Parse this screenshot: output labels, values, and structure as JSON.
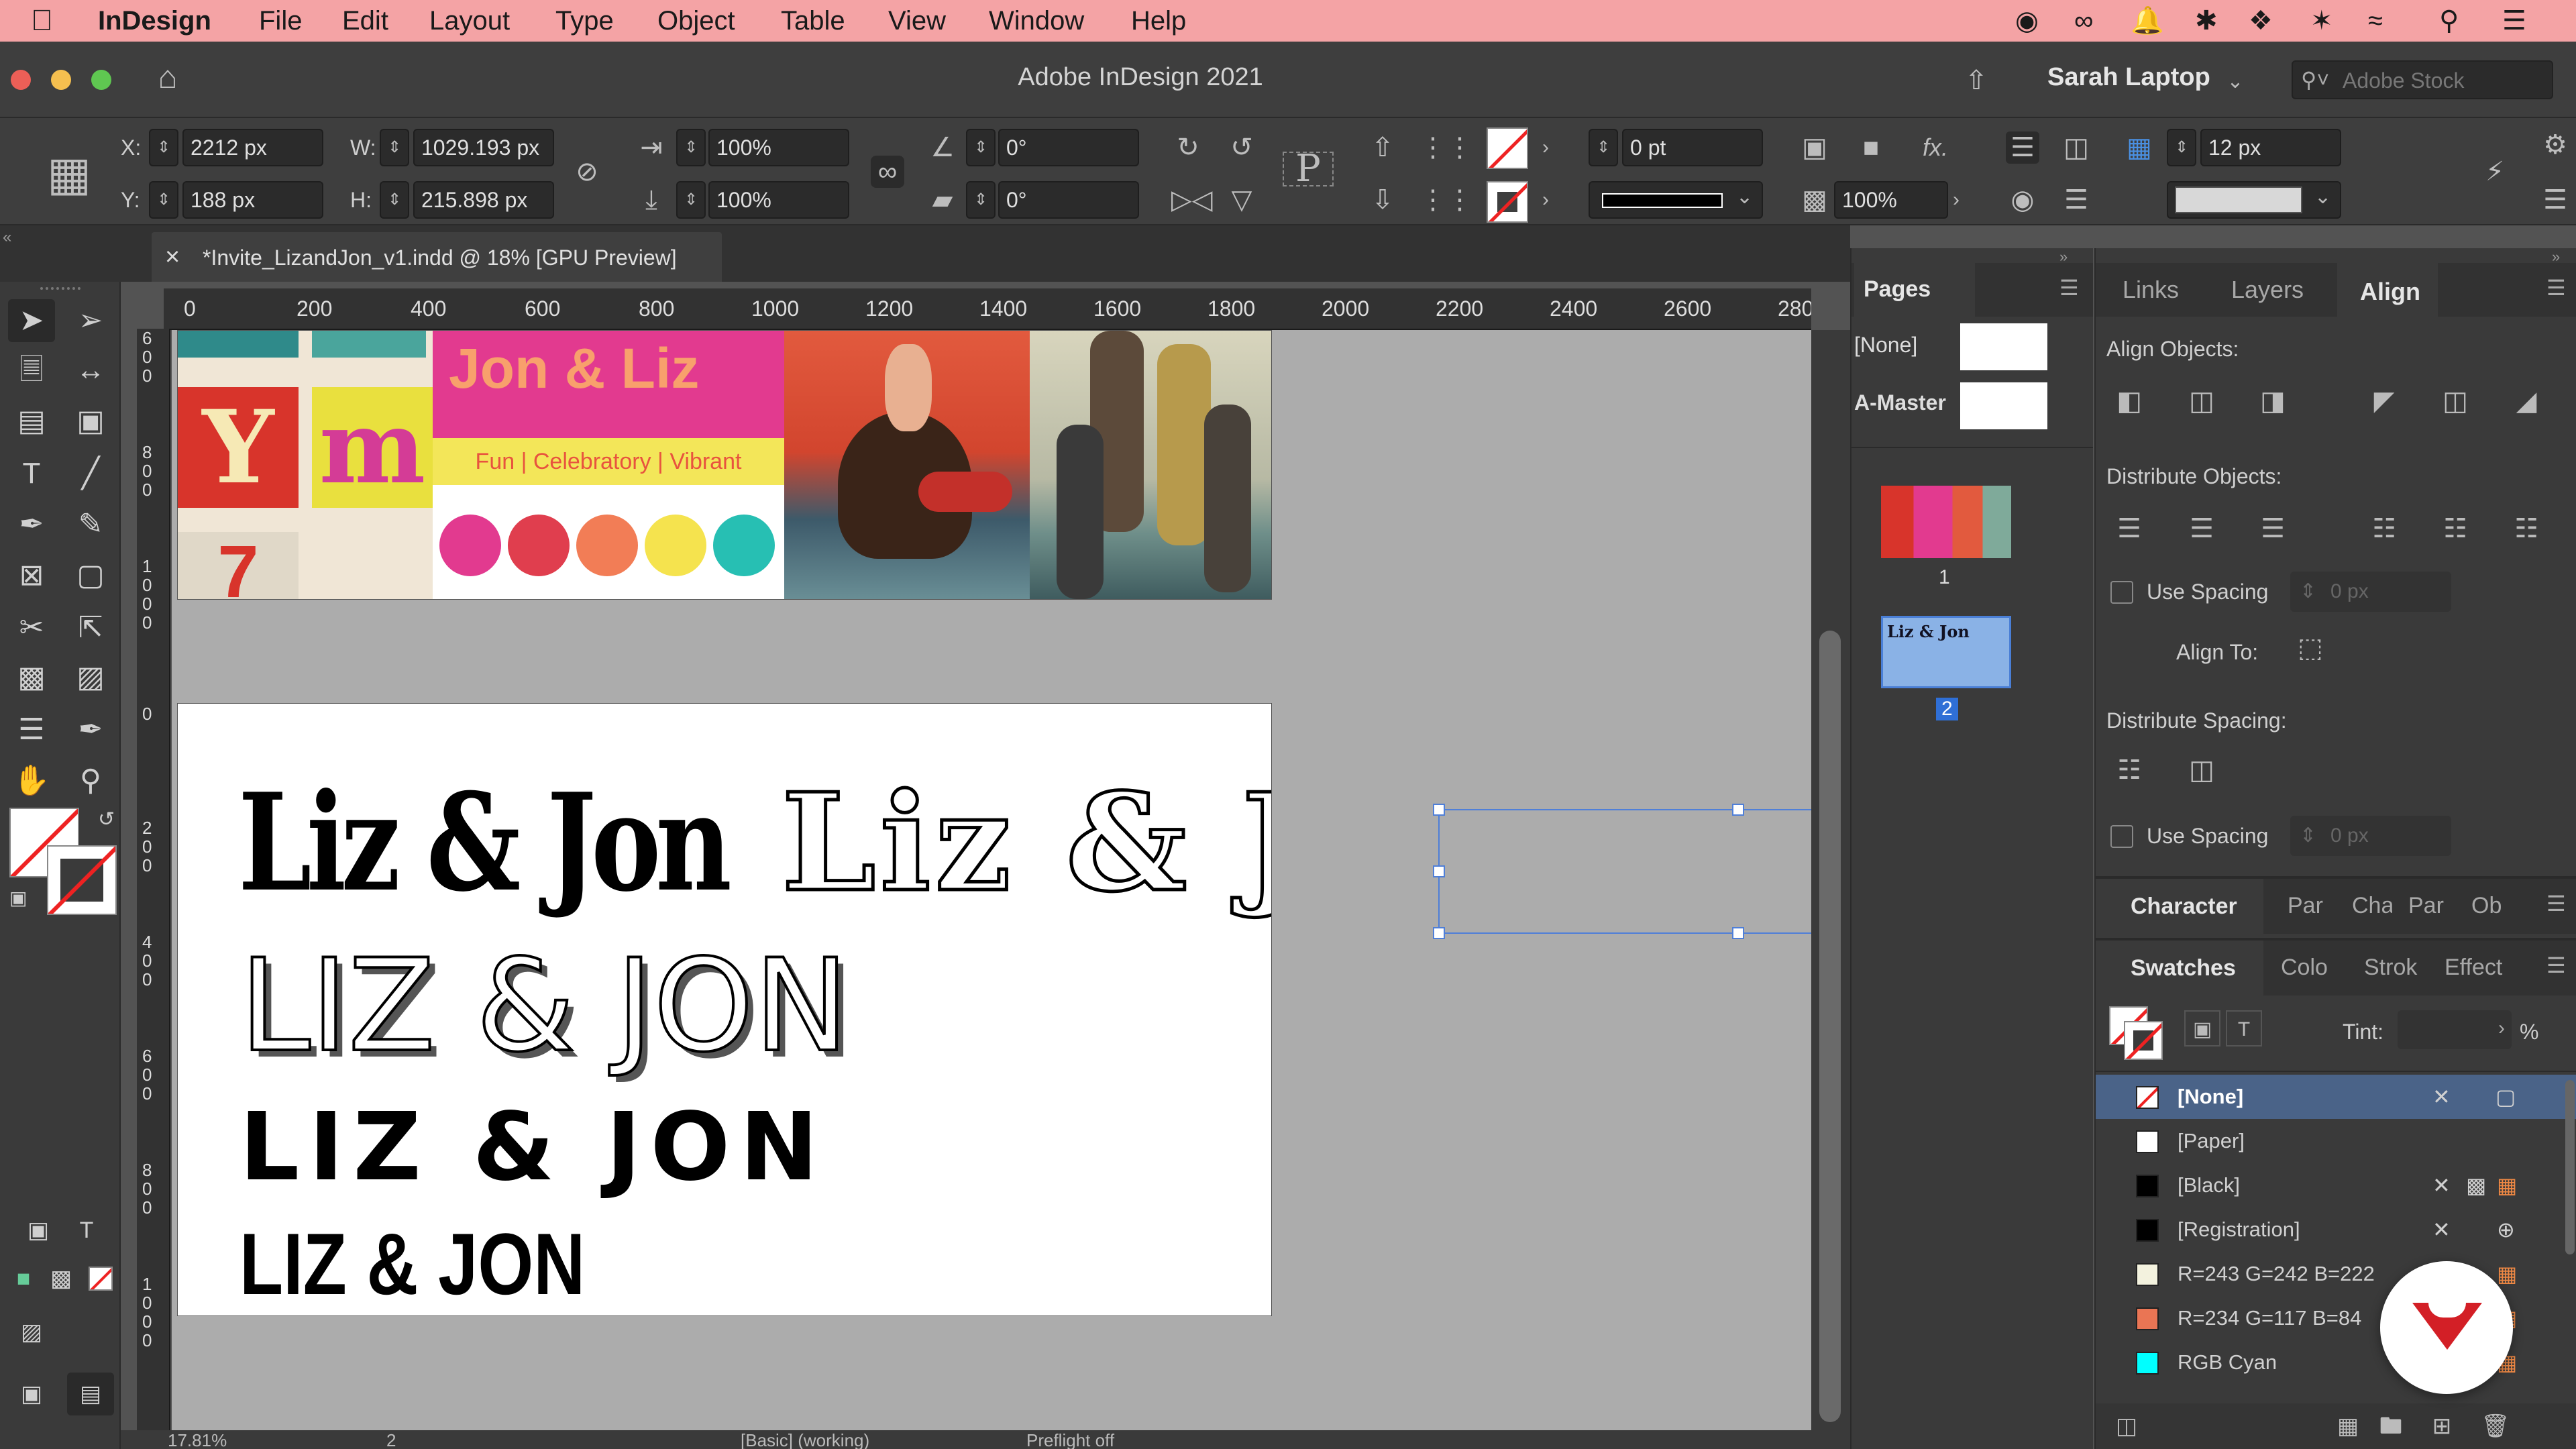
{
  "menubar": {
    "app": "InDesign",
    "items": [
      "File",
      "Edit",
      "Layout",
      "Type",
      "Object",
      "Table",
      "View",
      "Window",
      "Help"
    ]
  },
  "window": {
    "title": "Adobe InDesign 2021",
    "user": "Sarah Laptop",
    "search_placeholder": "Adobe Stock"
  },
  "control": {
    "x_label": "X:",
    "x": "2212 px",
    "y_label": "Y:",
    "y": "188 px",
    "w_label": "W:",
    "w": "1029.193 px",
    "h_label": "H:",
    "h": "215.898 px",
    "scale_x": "100%",
    "scale_y": "100%",
    "rotate": "0°",
    "shear": "0°",
    "ref_point": "P",
    "stroke_weight": "0 pt",
    "opacity": "100%",
    "fx": "fx.",
    "gap": "12 px"
  },
  "document_tab": {
    "title": "*Invite_LizandJon_v1.indd @ 18% [GPU Preview]",
    "close": "×"
  },
  "ruler": {
    "h_marks": [
      "0",
      "200",
      "400",
      "600",
      "800",
      "1000",
      "1200",
      "1400",
      "1600",
      "1800",
      "2000",
      "2200",
      "2400",
      "2600",
      "280"
    ],
    "v_marks": [
      "600",
      "800",
      "1000",
      "0",
      "200",
      "400",
      "600",
      "800",
      "1000"
    ]
  },
  "page1": {
    "heading": "Jon & Liz",
    "tagline": "Fun | Celebratory | Vibrant",
    "palette": [
      "#e23a8f",
      "#e03e4e",
      "#f27d56",
      "#f5e34e",
      "#27bfb3"
    ]
  },
  "page2": {
    "fonts": [
      "Liz & Jon",
      "Liz & Jon",
      "LIZ & JON",
      "LIZ & JON",
      "LIZ & JON"
    ]
  },
  "pages_panel": {
    "title": "Pages",
    "none": "[None]",
    "master": "A-Master",
    "page1": "1",
    "page2": "2",
    "thumb_text": "Liz & Jon"
  },
  "right_tabs": {
    "links": "Links",
    "layers": "Layers",
    "align": "Align"
  },
  "align": {
    "align_objects": "Align Objects:",
    "distribute_objects": "Distribute Objects:",
    "use_spacing": "Use Spacing",
    "spacing_value": "0 px",
    "align_to": "Align To:",
    "distribute_spacing": "Distribute Spacing:"
  },
  "character_row": {
    "title": "Character",
    "tabs": [
      "Par",
      "Cha",
      "Par",
      "Ob"
    ]
  },
  "swatches_row": {
    "title": "Swatches",
    "tabs": [
      "Colo",
      "Strok",
      "Effect"
    ]
  },
  "swatches": {
    "tint_label": "Tint:",
    "tint_unit": "%",
    "items": [
      {
        "name": "[None]",
        "color": "none"
      },
      {
        "name": "[Paper]",
        "color": "#ffffff"
      },
      {
        "name": "[Black]",
        "color": "#000000"
      },
      {
        "name": "[Registration]",
        "color": "#000000"
      },
      {
        "name": "R=243 G=242 B=222",
        "color": "#f3f2de"
      },
      {
        "name": "R=234 G=117 B=84",
        "color": "#ea7554"
      },
      {
        "name": "RGB Cyan",
        "color": "#00ffff"
      }
    ]
  },
  "statusbar": {
    "zoom": "17.81%",
    "page": "2",
    "style": "[Basic] (working)",
    "preflight": "Preflight off"
  }
}
